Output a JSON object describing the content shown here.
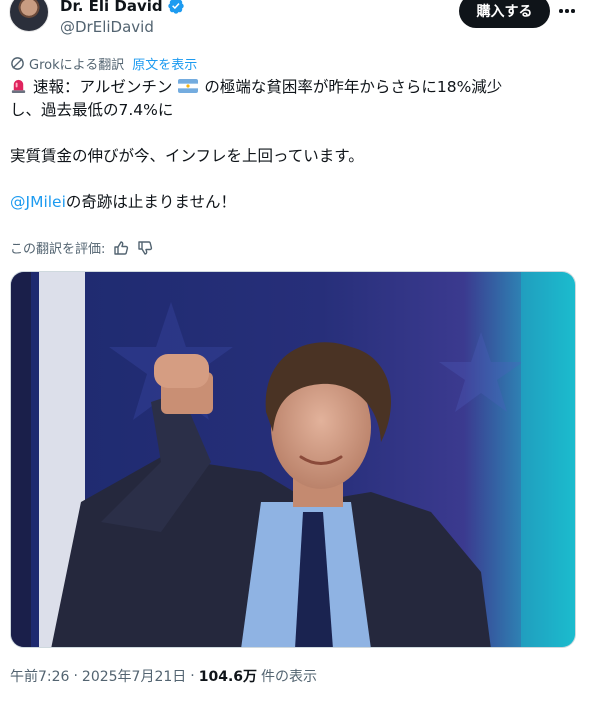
{
  "author": {
    "display_name": "Dr. Eli David",
    "handle": "@DrEliDavid"
  },
  "buy_button_label": "購入する",
  "translation": {
    "label": "Grokによる翻訳",
    "show_original": "原文を表示"
  },
  "tweet": {
    "line1_a": "速報：アルゼンチン",
    "line1_b": "の極端な貧困率が昨年からさらに18%減少",
    "line2": "し、過去最低の7.4%に",
    "line3": "実質賃金の伸びが今、インフレを上回っています。",
    "mention": "@JMilei",
    "line4_rest": "の奇跡は止まりません！"
  },
  "rate": {
    "label": "この翻訳を評価:"
  },
  "meta": {
    "time": "午前7:26",
    "sep1": "·",
    "date": "2025年7月21日",
    "sep2": "·",
    "views_count": "104.6万",
    "views_label": "件の表示"
  },
  "icons": {
    "verified": "verified-badge-icon",
    "more": "more-options-icon",
    "translate": "translate-icon",
    "siren": "siren-emoji-icon",
    "flag": "argentina-flag-icon",
    "thumbs_up": "thumbs-up-icon",
    "thumbs_down": "thumbs-down-icon"
  },
  "colors": {
    "link": "#1d9bf0",
    "text": "#0f1419",
    "muted": "#536471",
    "button_bg": "#0f1419"
  }
}
